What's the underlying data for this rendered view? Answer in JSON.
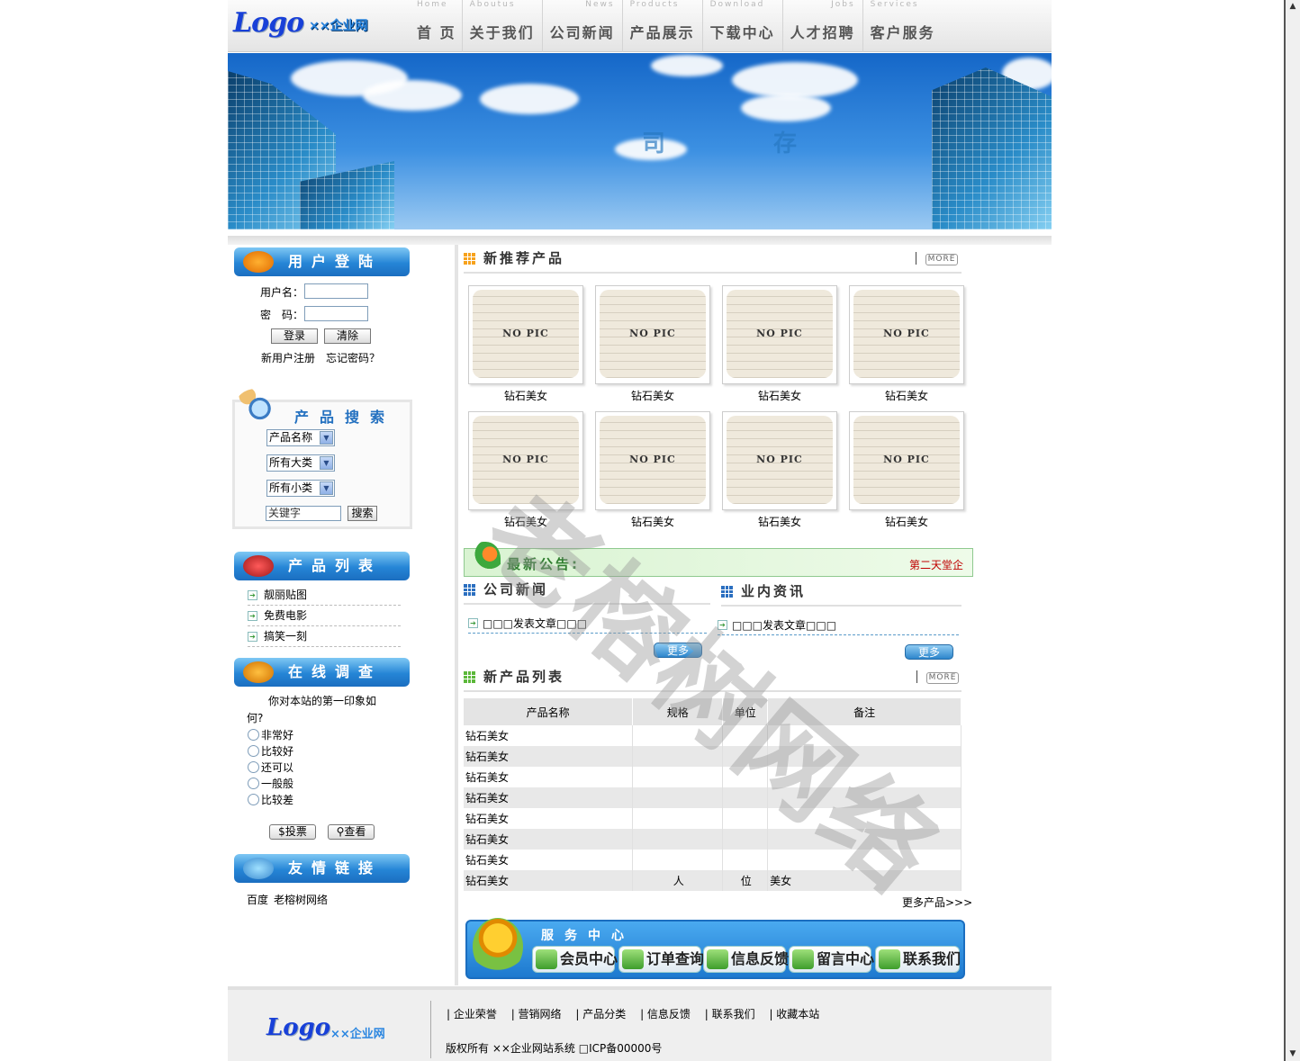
{
  "header": {
    "logo": "Logo",
    "logo_sub": "××企业网",
    "nav": [
      {
        "en": "Home",
        "cn": "首 页"
      },
      {
        "en": "Aboutus",
        "cn": "关于我们"
      },
      {
        "en": "News",
        "cn": "公司新闻"
      },
      {
        "en": "Products",
        "cn": "产品展示"
      },
      {
        "en": "Download",
        "cn": "下载中心"
      },
      {
        "en": "Jobs",
        "cn": "人才招聘"
      },
      {
        "en": "Services",
        "cn": "客户服务"
      }
    ]
  },
  "login": {
    "title": "用户登陆",
    "username_label": "用户名：",
    "password_label": "密　码：",
    "login_btn": "登录",
    "clear_btn": "清除",
    "register": "新用户注册",
    "forgot": "忘记密码？"
  },
  "search": {
    "title": "产品搜索",
    "field_select": "产品名称",
    "category_select": "所有大类",
    "subcategory_select": "所有小类",
    "keyword_placeholder": "关键字",
    "search_btn": "搜索"
  },
  "product_list": {
    "title": "产品列表",
    "items": [
      "靓丽贴图",
      "免费电影",
      "搞笑一刻"
    ]
  },
  "survey": {
    "title": "在线调查",
    "question_line1": "你对本站的第一印象如",
    "question_line2": "何?",
    "options": [
      "非常好",
      "比较好",
      "还可以",
      "一般般",
      "比较差"
    ],
    "vote_btn": "投票",
    "view_btn": "查看"
  },
  "links": {
    "title": "友情链接",
    "items": [
      "百度",
      "老榕树网络"
    ]
  },
  "recommended": {
    "title": "新推荐产品",
    "more": "MORE",
    "no_pic": "NO PIC",
    "products": [
      "钻石美女",
      "钻石美女",
      "钻石美女",
      "钻石美女",
      "钻石美女",
      "钻石美女",
      "钻石美女",
      "钻石美女"
    ]
  },
  "notice": {
    "title": "最新公告:",
    "text": "第二天堂企"
  },
  "company_news": {
    "title": "公司新闻",
    "item": "□□□发表文章□□□",
    "more": "更多>>>"
  },
  "industry_news": {
    "title": "业内资讯",
    "item": "□□□发表文章□□□",
    "more": "更多>>>"
  },
  "new_products": {
    "title": "新产品列表",
    "more": "MORE",
    "headers": [
      "产品名称",
      "规格",
      "单位",
      "备注"
    ],
    "rows": [
      [
        "钻石美女",
        "",
        "",
        ""
      ],
      [
        "钻石美女",
        "",
        "",
        ""
      ],
      [
        "钻石美女",
        "",
        "",
        ""
      ],
      [
        "钻石美女",
        "",
        "",
        ""
      ],
      [
        "钻石美女",
        "",
        "",
        ""
      ],
      [
        "钻石美女",
        "",
        "",
        ""
      ],
      [
        "钻石美女",
        "",
        "",
        ""
      ],
      [
        "钻石美女",
        "人",
        "位",
        "美女"
      ]
    ],
    "more_products": "更多产品>>>"
  },
  "service": {
    "title": "服务中心",
    "buttons": [
      "会员中心",
      "订单查询",
      "信息反馈",
      "留言中心",
      "联系我们"
    ]
  },
  "footer": {
    "logo": "Logo",
    "logo_sub": "××企业网",
    "links": [
      "| 企业荣誉",
      "| 营销网络",
      "| 产品分类",
      "| 信息反馈",
      "| 联系我们",
      "| 收藏本站"
    ],
    "copyright": "版权所有 ××企业网站系统 □ICP备00000号"
  },
  "watermark": "老榕树网络",
  "colors": {
    "accent": "#2585d6",
    "link_green": "#3a9a3a",
    "notice_red": "#c00000"
  }
}
